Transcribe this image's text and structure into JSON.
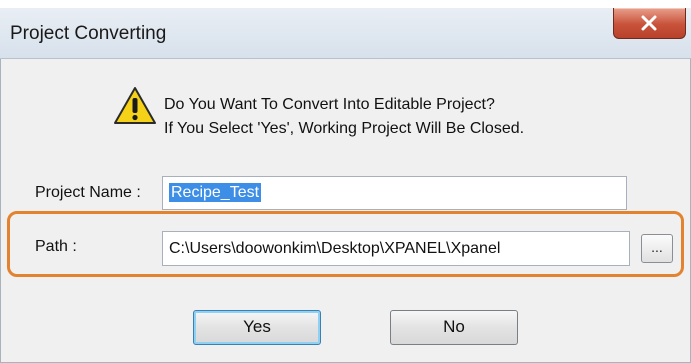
{
  "dialog": {
    "title": "Project Converting",
    "message_line1": "Do You Want To Convert Into Editable Project?",
    "message_line2": "If You Select 'Yes', Working Project Will Be Closed."
  },
  "form": {
    "project_name_label": "Project Name :",
    "project_name_value": "Recipe_Test",
    "path_label": "Path :",
    "path_value": "C:\\Users\\doowonkim\\Desktop\\XPANEL\\Xpanel",
    "browse_label": "..."
  },
  "buttons": {
    "yes_label": "Yes",
    "no_label": "No"
  },
  "icons": {
    "warning": "warning-triangle-icon",
    "close": "close-x-icon"
  },
  "colors": {
    "highlight": "#e3822f",
    "selection": "#3d8ee6",
    "close_button": "#c8523a",
    "warning_yellow": "#f5d217"
  }
}
